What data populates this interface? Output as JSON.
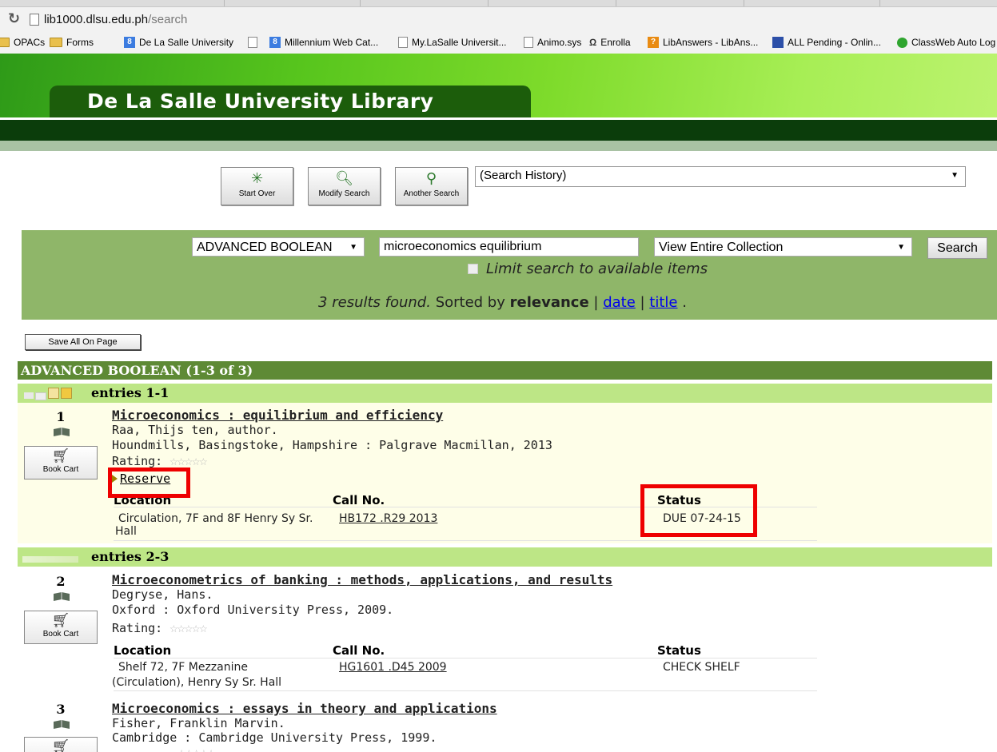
{
  "browser": {
    "url_host": "lib1000.dlsu.edu.ph",
    "url_path": "/search",
    "bookmarks": [
      "OPACs",
      "Forms",
      "De La Salle University",
      "Millennium Web Cat...",
      "My.LaSalle Universit...",
      "Animo.sys",
      "Enrolla",
      "LibAnswers - LibAns...",
      "ALL Pending - Onlin...",
      "ClassWeb Auto Log"
    ]
  },
  "header": {
    "title": "De La Salle University Library"
  },
  "toolbar": {
    "start_over": "Start Over",
    "modify_search": "Modify Search",
    "another_search": "Another Search",
    "history": "(Search History)"
  },
  "search": {
    "type": "ADVANCED BOOLEAN",
    "query": "microeconomics equilibrium",
    "scope": "View Entire Collection",
    "button": "Search",
    "limit_label": "Limit search to available items",
    "results_text": "3 results found.",
    "sorted_by_prefix": "Sorted by",
    "sorted_current": "relevance",
    "sort_date": "date",
    "sort_title": "title"
  },
  "actions": {
    "save_all": "Save All On Page"
  },
  "results": {
    "heading": "ADVANCED BOOLEAN (1-3 of 3)",
    "group1": "entries 1-1",
    "group2": "entries 2-3",
    "headers": {
      "location": "Location",
      "call_no": "Call No.",
      "status": "Status"
    },
    "rating_label": "Rating:",
    "cart_label": "Book Cart",
    "reserve_label": "Reserve",
    "items": [
      {
        "num": "1",
        "title": "Microeconomics : equilibrium and efficiency",
        "author": "Raa, Thijs ten, author.",
        "publisher": "Houndmills, Basingstoke, Hampshire : Palgrave Macmillan, 2013",
        "location_line1": "Circulation, 7F and 8F Henry Sy Sr.",
        "location_line2": "Hall",
        "call_no": "HB172 .R29 2013",
        "status": "DUE 07-24-15"
      },
      {
        "num": "2",
        "title": "Microeconometrics of banking : methods, applications, and results",
        "author": "Degryse, Hans.",
        "publisher": "Oxford : Oxford University Press, 2009.",
        "location_line1": "Shelf 72, 7F Mezzanine",
        "location_line2": "(Circulation), Henry Sy Sr. Hall",
        "call_no": "HG1601 .D45 2009",
        "status": "CHECK SHELF"
      },
      {
        "num": "3",
        "title": "Microeconomics : essays in theory and applications",
        "author": "Fisher, Franklin Marvin.",
        "publisher": "Cambridge : Cambridge University Press, 1999."
      }
    ]
  },
  "colors": {
    "highlight": "#ee0000",
    "search_panel": "#8fb669",
    "entries_bar": "#bde686",
    "item_bg": "#fefee8"
  }
}
